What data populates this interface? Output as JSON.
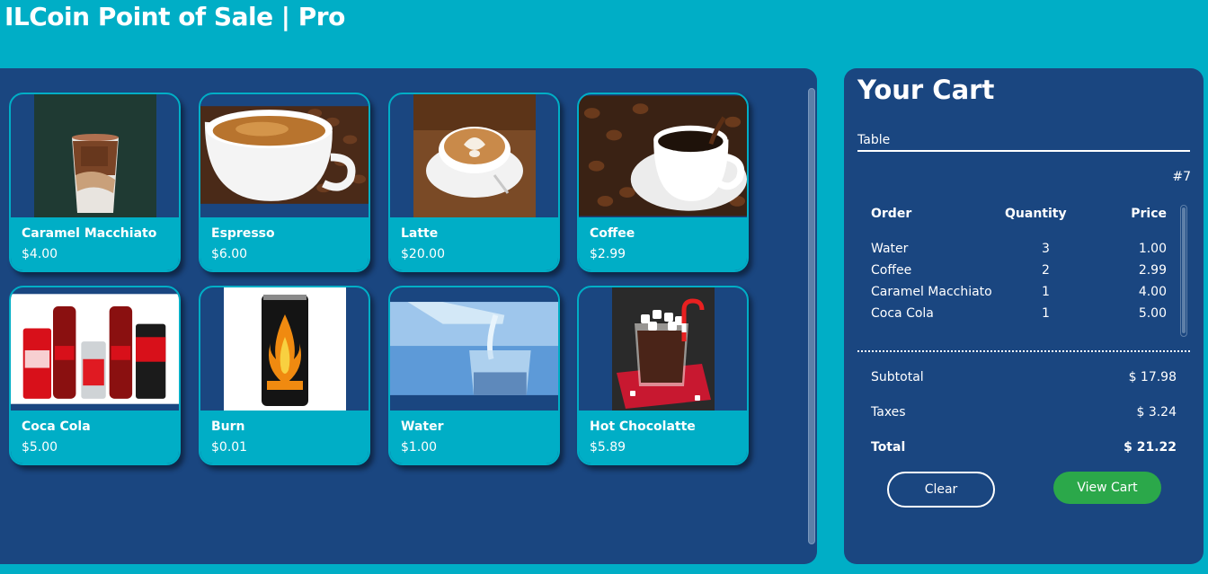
{
  "app": {
    "title": "ILCoin Point of Sale | Pro"
  },
  "products": [
    {
      "name": "Caramel Macchiato",
      "price": "$4.00",
      "image": "iced-caramel-macchiato"
    },
    {
      "name": "Espresso",
      "price": "$6.00",
      "image": "espresso-cup"
    },
    {
      "name": "Latte",
      "price": "$20.00",
      "image": "latte-art-cup"
    },
    {
      "name": "Coffee",
      "price": "$2.99",
      "image": "coffee-beans-cup"
    },
    {
      "name": "Coca Cola",
      "price": "$5.00",
      "image": "coca-cola-bottles"
    },
    {
      "name": "Burn",
      "price": "$0.01",
      "image": "burn-energy-can"
    },
    {
      "name": "Water",
      "price": "$1.00",
      "image": "water-glass"
    },
    {
      "name": "Hot Chocolatte",
      "price": "$5.89",
      "image": "hot-chocolate-mug"
    }
  ],
  "cart": {
    "title": "Your Cart",
    "table_label": "Table",
    "table_number": "#7",
    "columns": {
      "order": "Order",
      "quantity": "Quantity",
      "price": "Price"
    },
    "items": [
      {
        "name": "Water",
        "qty": "3",
        "price": "1.00"
      },
      {
        "name": "Coffee",
        "qty": "2",
        "price": "2.99"
      },
      {
        "name": "Caramel Macchiato",
        "qty": "1",
        "price": "4.00"
      },
      {
        "name": "Coca Cola",
        "qty": "1",
        "price": "5.00"
      }
    ],
    "subtotal_label": "Subtotal",
    "subtotal": "$ 17.98",
    "taxes_label": "Taxes",
    "taxes": "$ 3.24",
    "total_label": "Total",
    "total": "$ 21.22",
    "clear_label": "Clear",
    "view_label": "View Cart"
  },
  "colors": {
    "background": "#00aec6",
    "panel": "#1a4680",
    "accent": "#00aec6",
    "view_button": "#2ba84a"
  }
}
